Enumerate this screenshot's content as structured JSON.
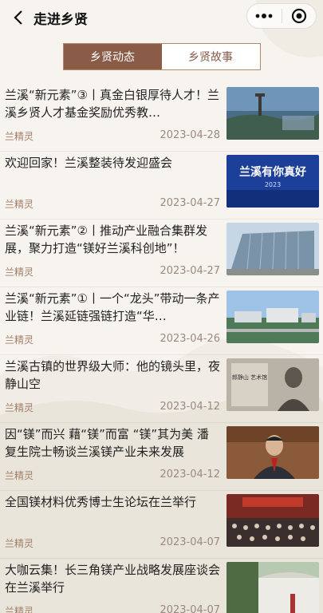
{
  "header": {
    "title": "走进乡贤",
    "back_icon": "chevron-left-icon",
    "menu_icon": "more-dots-icon",
    "close_icon": "target-circle-icon"
  },
  "tabs": [
    {
      "label": "乡贤动态",
      "active": true
    },
    {
      "label": "乡贤故事",
      "active": false
    }
  ],
  "colors": {
    "accent": "#8a5b47",
    "meta": "#a07e68"
  },
  "articles": [
    {
      "title": "兰溪“新元素”③丨真金白银厚待人才！兰溪乡贤人才基金奖励优秀教…",
      "source": "兰精灵",
      "date": "2023-04-28"
    },
    {
      "title": "欢迎回家！兰溪整装待发迎盛会",
      "source": "兰精灵",
      "date": "2023-04-27",
      "image_text": "兰溪有你真好",
      "image_year": "2023"
    },
    {
      "title": "兰溪“新元素”②丨推动产业融合集群发展，聚力打造“镁好兰溪科创地”！",
      "source": "兰精灵",
      "date": "2023-04-27"
    },
    {
      "title": "兰溪“新元素”①丨一个“龙头”带动一条产业链！兰溪延链强链打造“华…",
      "source": "兰精灵",
      "date": "2023-04-26"
    },
    {
      "title": "兰溪古镇的世界级大师：他的镜头里，夜静山空",
      "source": "兰精灵",
      "date": "2023-04-12",
      "image_text": "郎静山 艺术馆"
    },
    {
      "title": "因“镁”而兴 藉“镁”而富 “镁”其为美 潘复生院士畅谈兰溪镁产业未来发展",
      "source": "兰精灵",
      "date": "2023-04-12"
    },
    {
      "title": "全国镁材料优秀博士生论坛在兰举行",
      "source": "兰精灵",
      "date": "2023-04-07"
    },
    {
      "title": "大咖云集！长三角镁产业战略发展座谈会在兰溪举行",
      "source": "兰精灵",
      "date": "2023-04-07"
    }
  ]
}
